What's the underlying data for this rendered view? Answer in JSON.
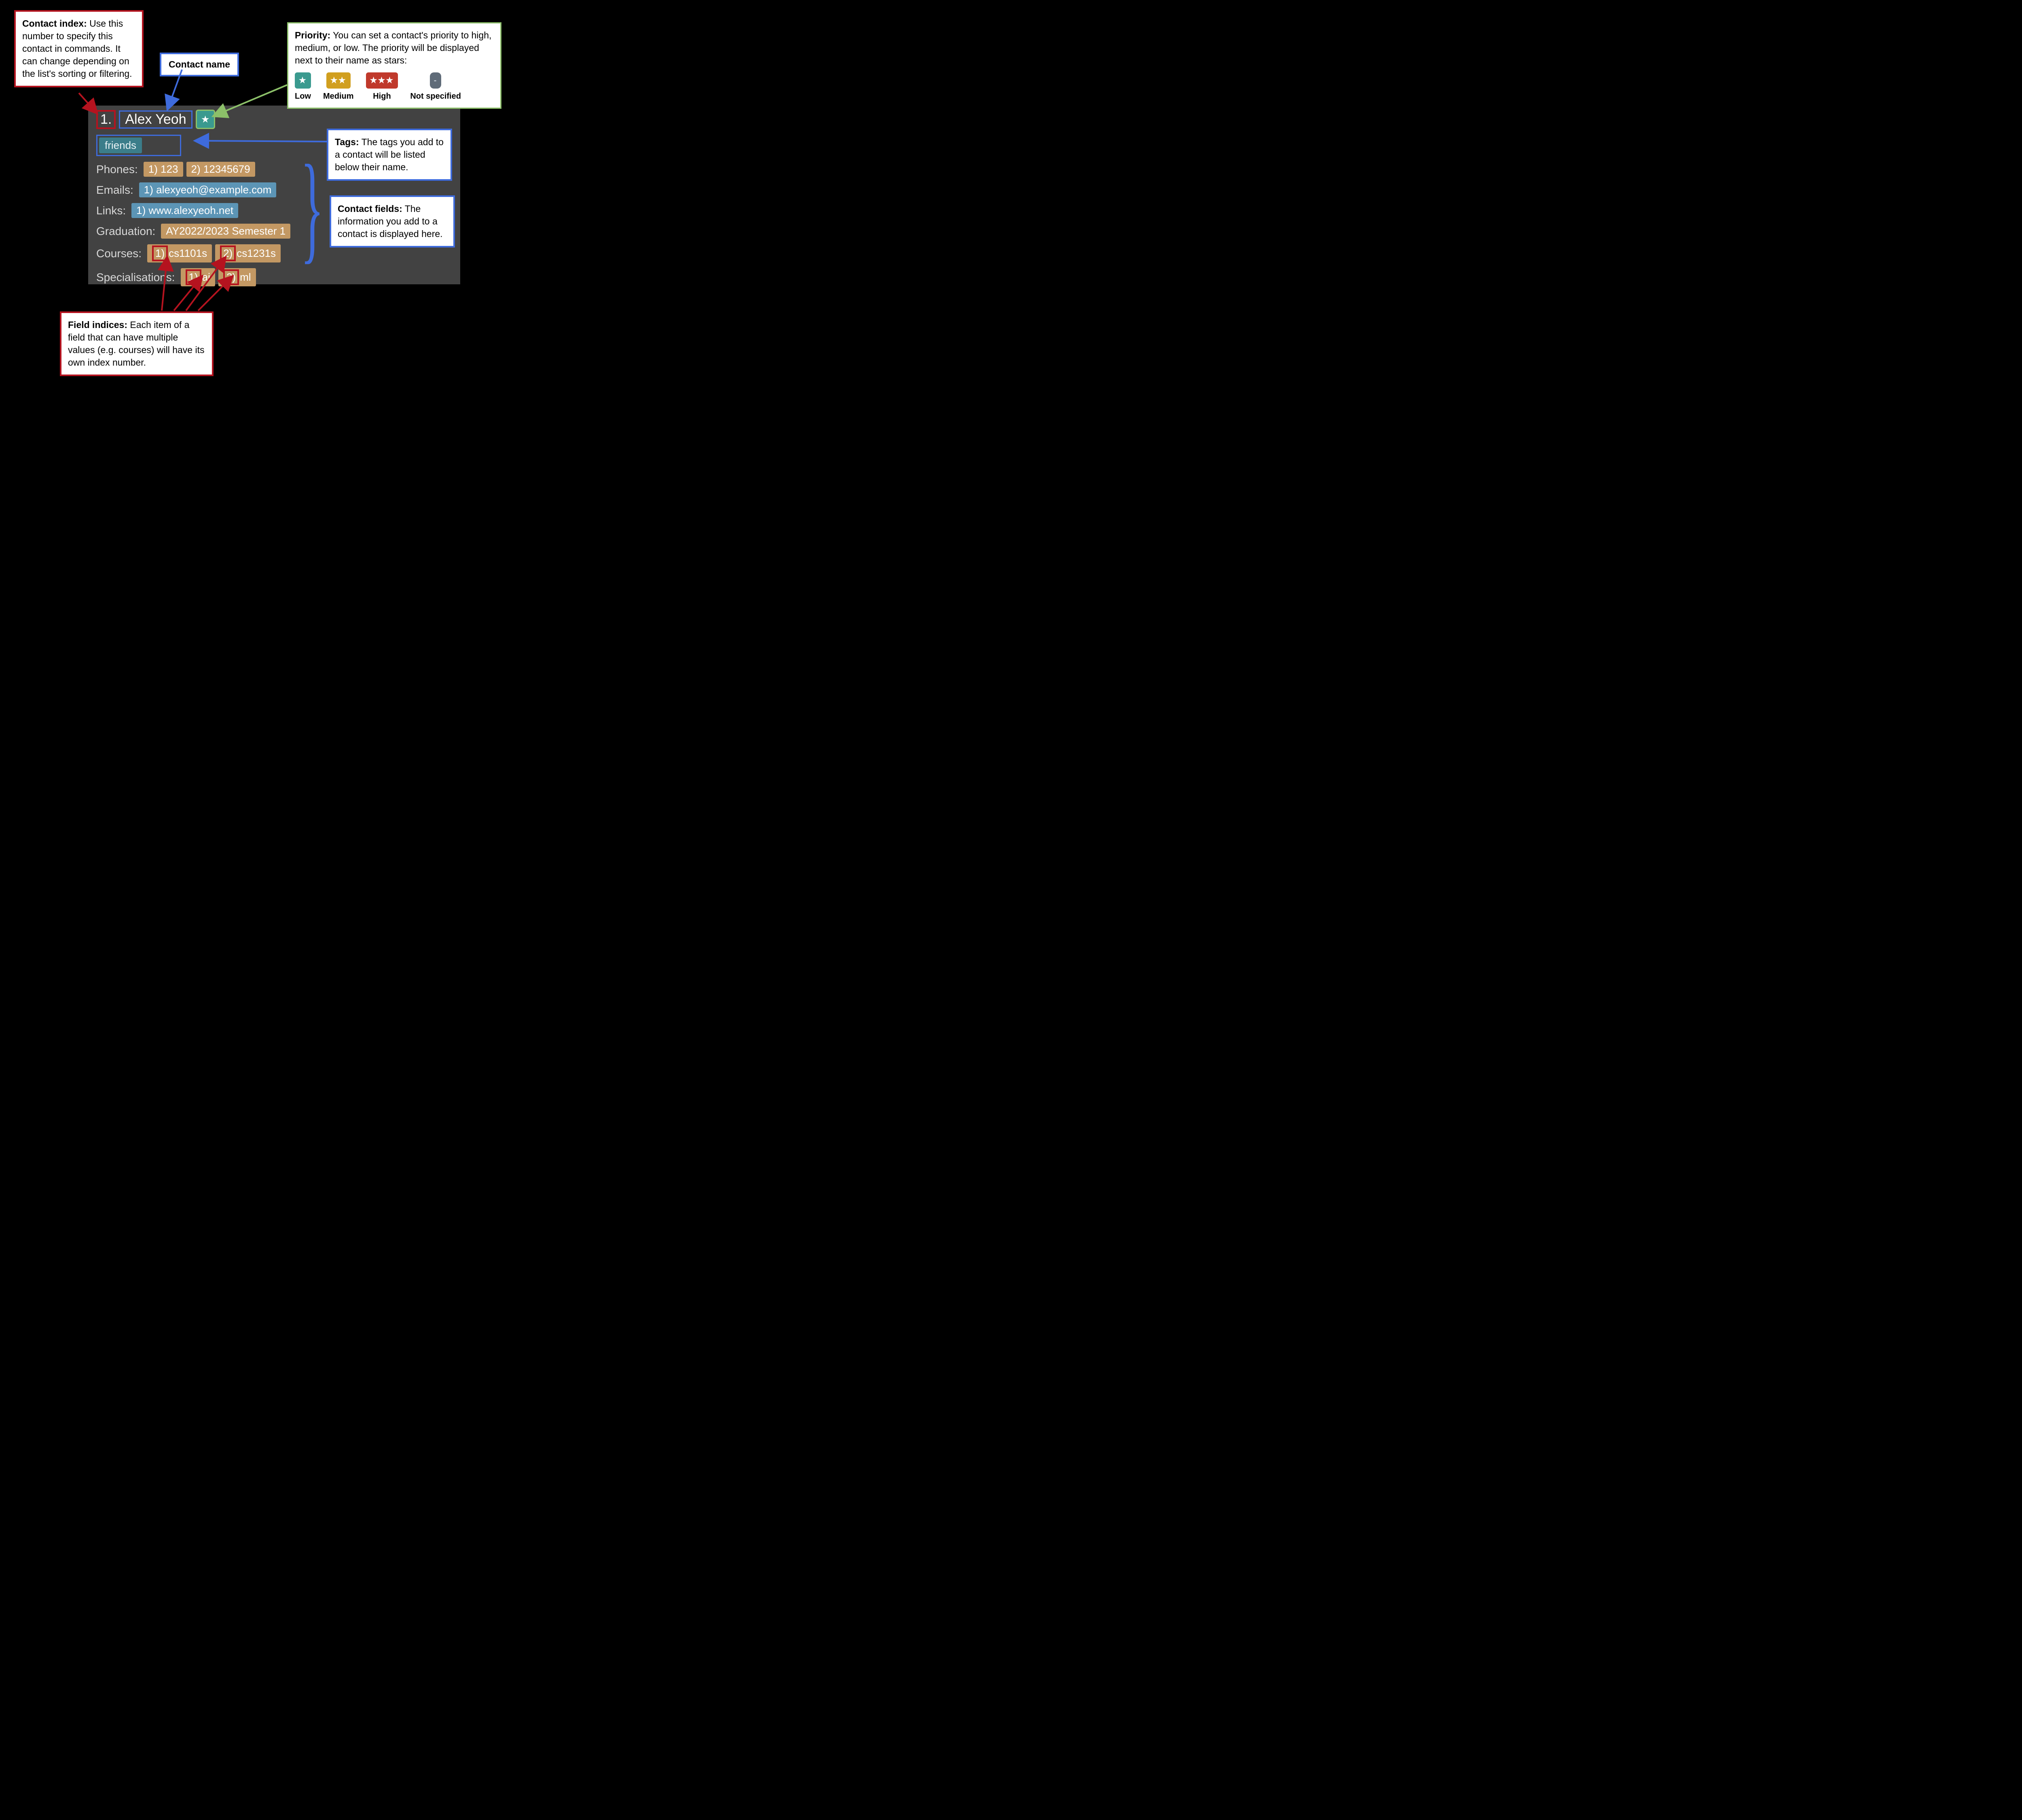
{
  "callouts": {
    "contactIndex": {
      "title": "Contact index:",
      "body": "Use this number to specify this contact in commands. It can change depending on the list's sorting or filtering."
    },
    "contactName": {
      "title": "Contact name"
    },
    "priority": {
      "title": "Priority:",
      "body": "You can set a contact's priority to high, medium, or low. The priority will be displayed next to their name as stars:",
      "legend": {
        "low": "Low",
        "medium": "Medium",
        "high": "High",
        "none": "Not specified"
      }
    },
    "tags": {
      "title": "Tags:",
      "body": "The tags you add to a contact will be listed below their name."
    },
    "fields": {
      "title": "Contact fields:",
      "body": "The information you add to a contact is displayed here."
    },
    "fieldIndices": {
      "title": "Field indices:",
      "body": "Each item of a field that can have multiple values (e.g. courses) will have its own index number."
    }
  },
  "contact": {
    "index": "1.",
    "name": "Alex Yeoh",
    "priorityStars": "★",
    "tags": [
      "friends"
    ],
    "labels": {
      "phones": "Phones:",
      "emails": "Emails:",
      "links": "Links:",
      "graduation": "Graduation:",
      "courses": "Courses:",
      "specialisations": "Specialisations:"
    },
    "phones": [
      {
        "idx": "1)",
        "val": "123"
      },
      {
        "idx": "2)",
        "val": "12345679"
      }
    ],
    "emails": [
      {
        "idx": "1)",
        "val": "alexyeoh@example.com"
      }
    ],
    "links": [
      {
        "idx": "1)",
        "val": "www.alexyeoh.net"
      }
    ],
    "graduation": "AY2022/2023 Semester 1",
    "courses": [
      {
        "idx": "1)",
        "val": "cs1101s"
      },
      {
        "idx": "2)",
        "val": "cs1231s"
      }
    ],
    "specialisations": [
      {
        "idx": "1)",
        "val": "ai"
      },
      {
        "idx": "2)",
        "val": "ml"
      }
    ]
  },
  "legendStars": {
    "low": "★",
    "med": "★★",
    "high": "★★★",
    "none": "-"
  }
}
